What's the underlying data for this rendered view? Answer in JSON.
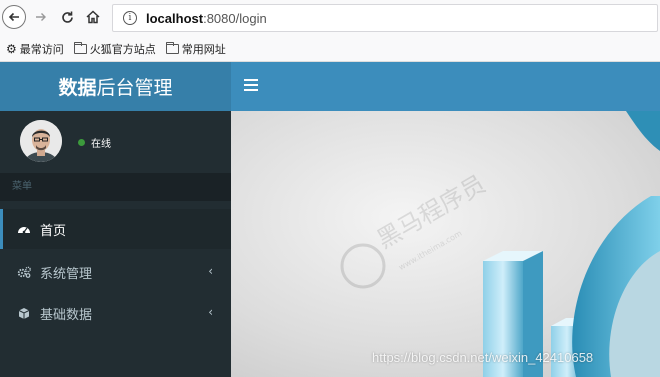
{
  "browser": {
    "url_host": "localhost",
    "url_rest": ":8080/login",
    "info_icon": "i",
    "bookmarks": [
      "最常访问",
      "火狐官方站点",
      "常用网址"
    ]
  },
  "header": {
    "logo_bold": "数据",
    "logo_light": "后台管理",
    "accent_color": "#3c8dbc"
  },
  "sidebar": {
    "status": "在线",
    "menu_header": "菜单",
    "items": [
      {
        "label": "首页",
        "icon": "dashboard-icon",
        "active": true
      },
      {
        "label": "系统管理",
        "icon": "cogs-icon",
        "has_children": true
      },
      {
        "label": "基础数据",
        "icon": "cube-icon",
        "has_children": true
      }
    ]
  },
  "content": {
    "watermark_url": "https://blog.csdn.net/weixin_42410658"
  }
}
